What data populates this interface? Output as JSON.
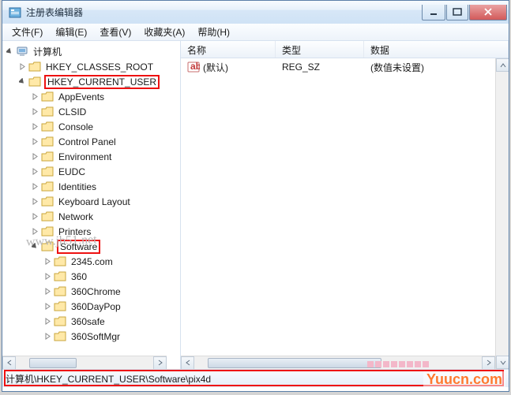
{
  "titlebar": {
    "title": "注册表编辑器"
  },
  "menu": {
    "file": "文件(F)",
    "edit": "编辑(E)",
    "view": "查看(V)",
    "favorites": "收藏夹(A)",
    "help": "帮助(H)"
  },
  "tree": {
    "root": "计算机",
    "hkcr": "HKEY_CLASSES_ROOT",
    "hkcu": "HKEY_CURRENT_USER",
    "appevents": "AppEvents",
    "clsid": "CLSID",
    "console": "Console",
    "controlpanel": "Control Panel",
    "environment": "Environment",
    "eudc": "EUDC",
    "identities": "Identities",
    "keyboard": "Keyboard Layout",
    "network": "Network",
    "printers": "Printers",
    "software": "Software",
    "s2345": "2345.com",
    "s360": "360",
    "s360chrome": "360Chrome",
    "s360daypop": "360DayPop",
    "s360safe": "360safe",
    "s360softmgr": "360SoftMgr"
  },
  "list": {
    "headers": {
      "name": "名称",
      "type": "类型",
      "data": "数据"
    },
    "rows": [
      {
        "name": "(默认)",
        "type": "REG_SZ",
        "data": "(数值未设置)"
      }
    ]
  },
  "status": {
    "path": "计算机\\HKEY_CURRENT_USER\\Software\\pix4d"
  },
  "watermark": "www.jb51.net",
  "brand": "Yuucn.com"
}
